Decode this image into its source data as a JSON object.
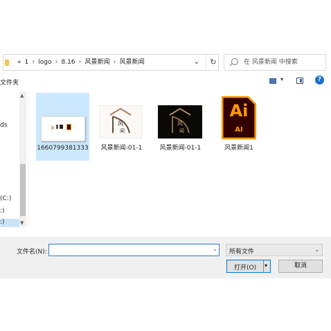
{
  "address": {
    "overflow": "«",
    "crumbs": [
      "1",
      "logo",
      "8.16",
      "风景新闻",
      "风景新闻"
    ],
    "separator": "›",
    "dropdown_glyph": "⌄",
    "refresh_glyph": "↻",
    "search_placeholder": "在 风景新闻 中搜索"
  },
  "toolbar": {
    "new_folder_label": "文件夹",
    "view_dropdown_glyph": "▾",
    "help_label": "?"
  },
  "nav": {
    "items": [
      "ds",
      "(C:)",
      ":)",
      ":)"
    ],
    "scroll_up": "▲",
    "scroll_down": "▼"
  },
  "files": [
    {
      "name": "1660799381333",
      "type": "image",
      "selected": true
    },
    {
      "name": "风景新闻-01-1",
      "type": "logo-light"
    },
    {
      "name": "风景新闻-01-1",
      "type": "logo-dark"
    },
    {
      "name": "风景新闻1",
      "type": "ai"
    }
  ],
  "ai_icon": {
    "big": "Ai",
    "small": "AI",
    "bg": "#330000",
    "accent": "#ff9a00"
  },
  "bottom": {
    "filename_label": "文件名(N):",
    "filename_value": "",
    "filetype_value": "所有文件",
    "open_label": "打开(O)",
    "cancel_label": "取消",
    "dropdown_glyph": "⌄",
    "open_dropdown_glyph": "▾"
  },
  "colors": {
    "selection": "#cce8ff",
    "accent": "#0078d7",
    "help": "#1c6fd1"
  }
}
